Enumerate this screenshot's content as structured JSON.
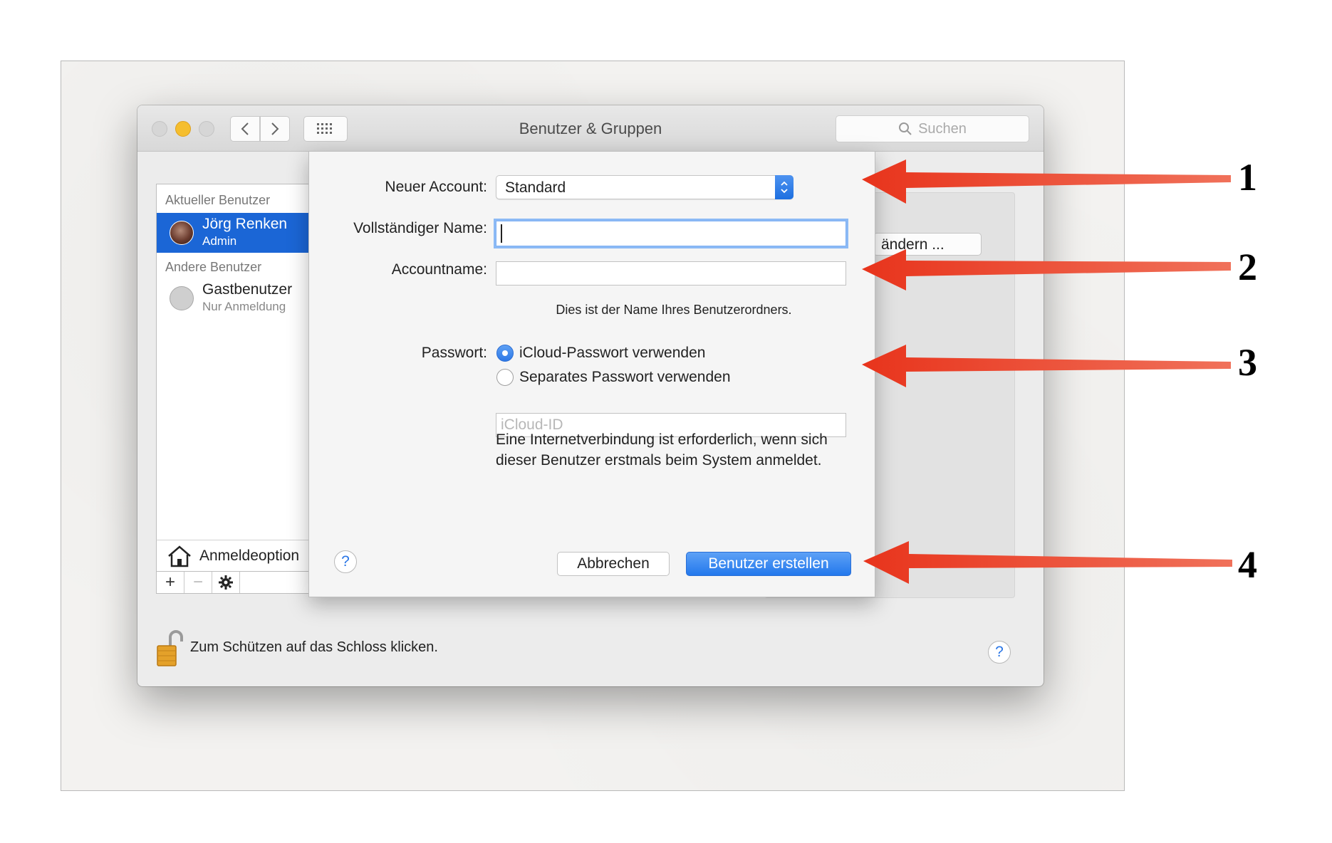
{
  "window": {
    "title": "Benutzer & Gruppen",
    "search_placeholder": "Suchen"
  },
  "sidebar": {
    "current_user_header": "Aktueller Benutzer",
    "current_user": {
      "name": "Jörg Renken",
      "role": "Admin"
    },
    "other_users_header": "Andere Benutzer",
    "other_users": [
      {
        "name": "Gastbenutzer",
        "role": "Nur Anmeldung"
      }
    ],
    "login_options_label": "Anmeldeoption",
    "add_label": "+",
    "remove_label": "−"
  },
  "background": {
    "change_button_label": "ändern ...",
    "lock_text": "Zum Schützen auf das Schloss klicken.",
    "help_label": "?"
  },
  "sheet": {
    "new_account_label": "Neuer Account:",
    "new_account_value": "Standard",
    "full_name_label": "Vollständiger Name:",
    "full_name_value": "",
    "account_name_label": "Accountname:",
    "account_name_value": "",
    "account_name_hint": "Dies ist der Name Ihres Benutzerordners.",
    "password_label": "Passwort:",
    "password_options": [
      {
        "label": "iCloud-Passwort verwenden",
        "selected": true
      },
      {
        "label": "Separates Passwort verwenden",
        "selected": false
      }
    ],
    "icloud_id_placeholder": "iCloud-ID",
    "info_text": "Eine Internetverbindung ist erforderlich, wenn sich dieser Benutzer erstmals beim System anmeldet.",
    "help_label": "?",
    "cancel_label": "Abbrechen",
    "create_label": "Benutzer erstellen"
  },
  "annotations": {
    "arrow_color": "#e8341c",
    "numbers": [
      "1",
      "2",
      "3",
      "4"
    ]
  }
}
